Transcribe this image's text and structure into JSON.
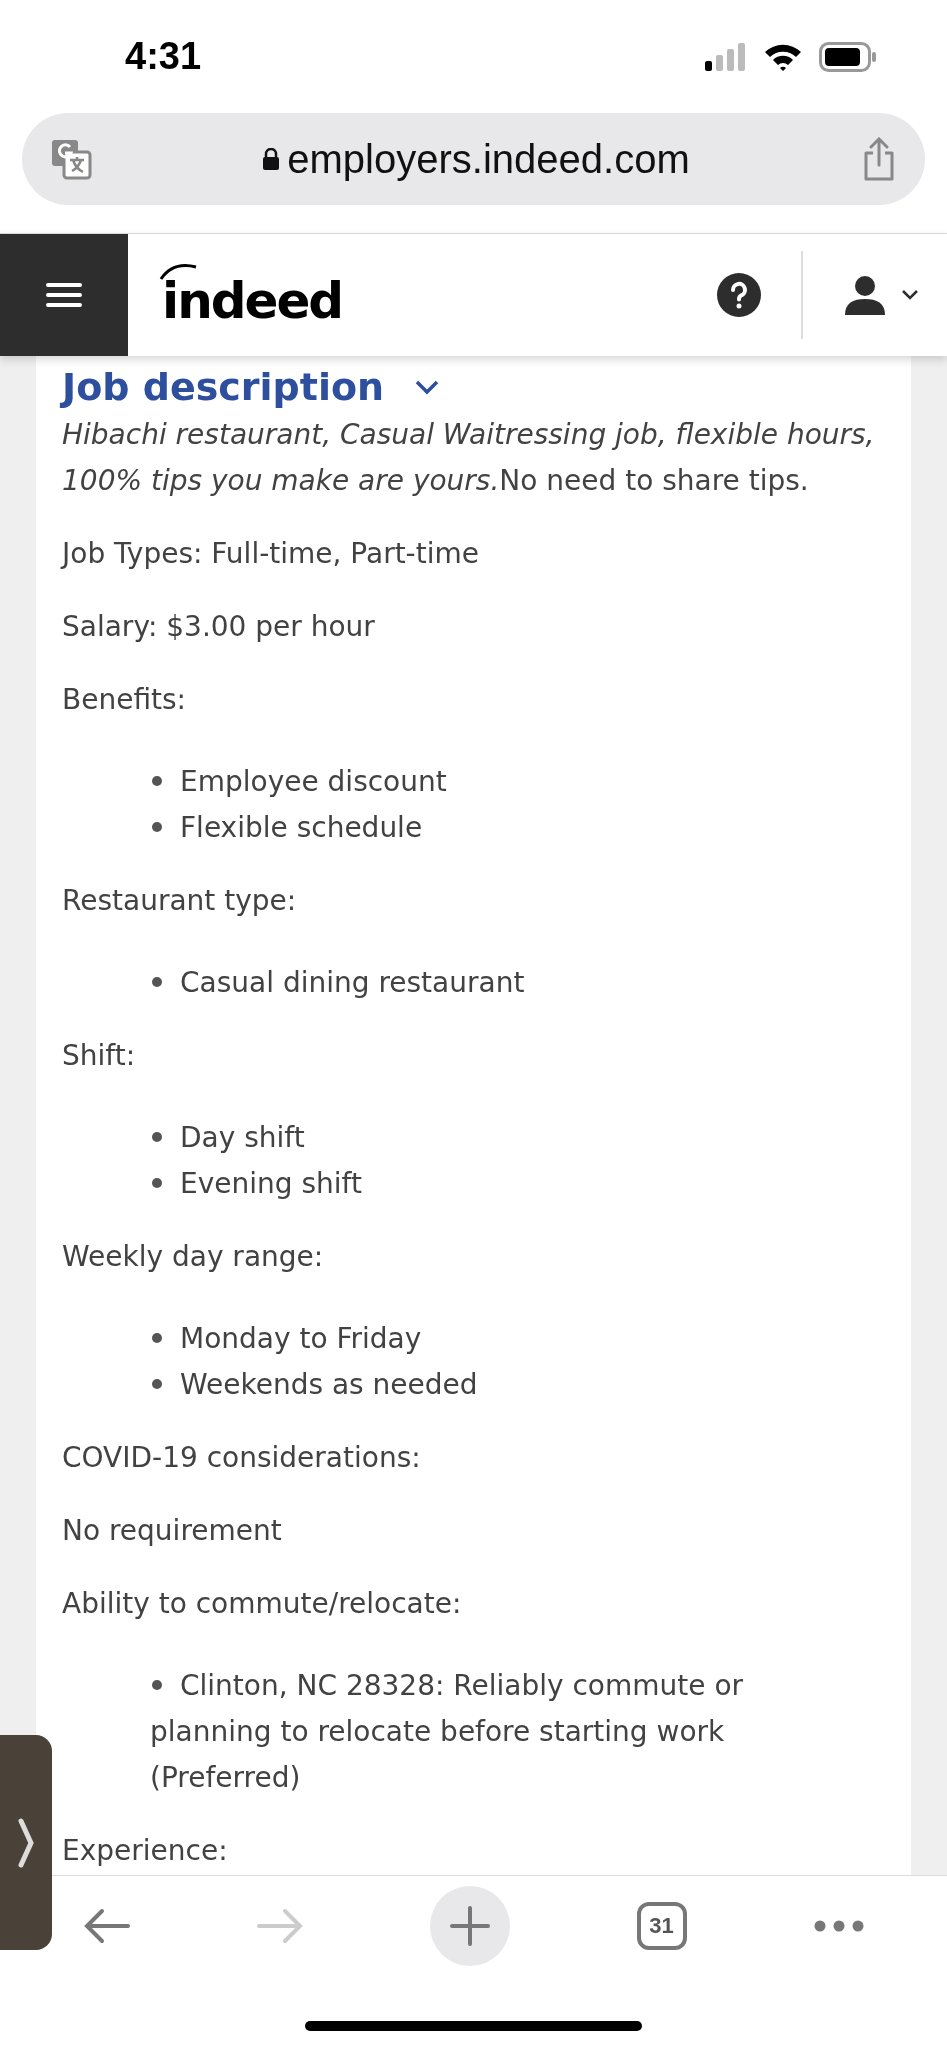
{
  "status_bar": {
    "time": "4:31"
  },
  "address_bar": {
    "url": "employers.indeed.com"
  },
  "nav": {
    "logo": "indeed"
  },
  "section": {
    "title": "Job description",
    "expanded": true,
    "intro": {
      "italic": "Hibachi restaurant, Casual Waitressing job, flexible hours, 100% tips you make are yours.",
      "plain": "No need to share tips."
    },
    "blocks": [
      {
        "kind": "paragraph",
        "text": "Job Types: Full-time, Part-time"
      },
      {
        "kind": "paragraph",
        "text": "Salary: $3.00 per hour"
      },
      {
        "kind": "paragraph",
        "text": "Benefits:"
      },
      {
        "kind": "list",
        "items": [
          "Employee discount",
          "Flexible schedule"
        ]
      },
      {
        "kind": "paragraph",
        "text": "Restaurant type:"
      },
      {
        "kind": "list",
        "items": [
          "Casual dining restaurant"
        ]
      },
      {
        "kind": "paragraph",
        "text": "Shift:"
      },
      {
        "kind": "list",
        "items": [
          "Day shift",
          "Evening shift"
        ]
      },
      {
        "kind": "paragraph",
        "text": "Weekly day range:"
      },
      {
        "kind": "list",
        "items": [
          "Monday to Friday",
          "Weekends as needed"
        ]
      },
      {
        "kind": "paragraph",
        "text": "COVID-19 considerations:"
      },
      {
        "kind": "paragraph",
        "text": "No requirement"
      },
      {
        "kind": "paragraph",
        "text": "Ability to commute/relocate:"
      },
      {
        "kind": "list",
        "items": [
          "Clinton, NC 28328: Reliably commute or planning to relocate before starting work (Preferred)"
        ]
      },
      {
        "kind": "paragraph",
        "text": "Experience:"
      }
    ]
  },
  "toolbar": {
    "back_disabled": false,
    "forward_disabled": true,
    "tabs_count": "31"
  }
}
